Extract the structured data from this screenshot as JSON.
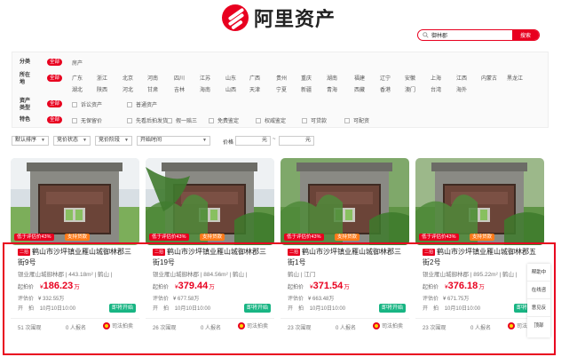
{
  "brand": {
    "name": "阿里资产"
  },
  "search": {
    "value": "御林郡",
    "button": "搜索"
  },
  "filters": {
    "all": "全部",
    "rows": [
      {
        "label": "分类",
        "options": [
          "房产"
        ]
      },
      {
        "label": "所在地",
        "options": [
          "广东",
          "浙江",
          "北京",
          "河南",
          "四川",
          "江苏",
          "山东",
          "广西",
          "贵州",
          "重庆",
          "湖南",
          "福建",
          "辽宁",
          "安徽",
          "上海",
          "江西",
          "内蒙古",
          "黑龙江",
          "湖北",
          "陕西",
          "河北",
          "甘肃",
          "吉林",
          "海南",
          "山西",
          "天津",
          "宁夏",
          "新疆",
          "青海",
          "西藏",
          "香港",
          "澳门",
          "台湾",
          "海外"
        ]
      },
      {
        "label": "资产类型",
        "options": [
          "诉讼资产",
          "普通资产"
        ]
      },
      {
        "label": "特色",
        "options": [
          "无保留价",
          "先看后拍发货",
          "假一赔三",
          "免费鉴定",
          "权威鉴定",
          "可贷款",
          "可配资"
        ]
      }
    ]
  },
  "sortbar": {
    "sort": "默认排序",
    "status": "竞价状态",
    "stage": "竞价阶段",
    "start_time": "开始时间",
    "price_label": "价格",
    "price_unit": "元",
    "tilde": "~"
  },
  "listing_labels": {
    "tag_eval": "低于评估价43%",
    "tag_loan": "支持贷款",
    "stage": "二拍",
    "start_price": "起拍价",
    "eval_price": "评估价",
    "start": "开　拍",
    "start_button": "即将开始",
    "views_suffix": "次围观",
    "signups": "0 人报名",
    "court": "司法拍卖",
    "yen": "¥",
    "wan": "万"
  },
  "listings": [
    {
      "title": "鹤山市沙坪镇业雁山城御林郡三街9号",
      "sub": "银业雁山城御林郡 | 443.18m² | 鹤山 |",
      "price": "186.23",
      "eval": "332.55万",
      "time": "10月10日10:00",
      "views": "51"
    },
    {
      "title": "鹤山市沙坪镇业雁山城御林郡三街19号",
      "sub": "银业雁山城御林郡 | 884.56m² | 鹤山 |",
      "price": "379.44",
      "eval": "677.58万",
      "time": "10月10日10:00",
      "views": "26"
    },
    {
      "title": "鹤山市沙坪镇业雁山城御林郡三街1号",
      "sub": "鹤山 | 江门",
      "price": "371.54",
      "eval": "663.48万",
      "time": "10月10日10:00",
      "views": "23"
    },
    {
      "title": "鹤山市沙坪镇业雁山城御林郡五街2号",
      "sub": "银业雁山城御林郡 | 895.22m² | 鹤山 |",
      "price": "376.18",
      "eval": "671.75万",
      "time": "10月10日10:00",
      "views": "23"
    }
  ],
  "sidefloat": [
    "帮助中",
    "在线咨",
    "意见反",
    "顶部"
  ]
}
